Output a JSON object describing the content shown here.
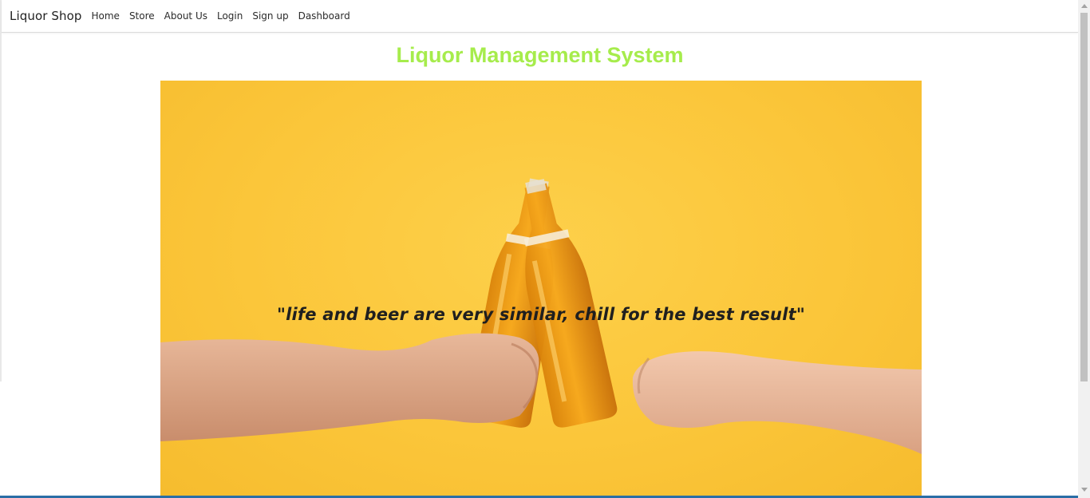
{
  "navbar": {
    "brand": "Liquor Shop",
    "links": [
      "Home",
      "Store",
      "About Us",
      "Login",
      "Sign up",
      "Dashboard"
    ]
  },
  "main": {
    "title": "Liquor Management System",
    "hero_quote": "\"life and beer are very similar, chill for the best result\""
  },
  "colors": {
    "title": "#a6ec4c",
    "hero_background": "#fbc63a",
    "quote_text": "#1f1f1f"
  },
  "icons": {
    "scroll_up": "chevron-up-icon",
    "scroll_down": "chevron-down-icon"
  }
}
